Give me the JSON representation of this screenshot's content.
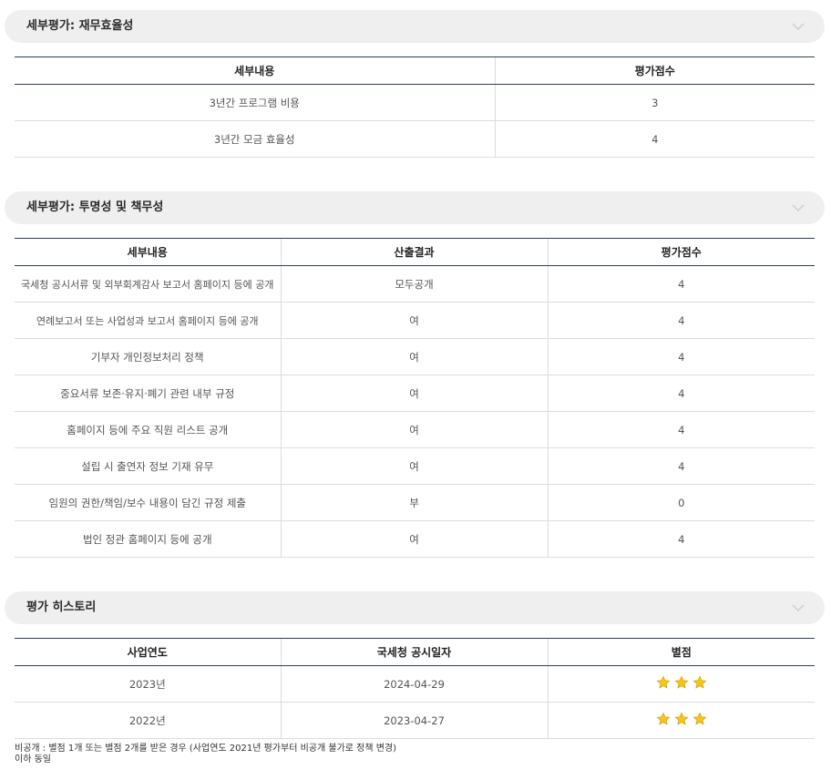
{
  "finance": {
    "title": "세부평가: 재무효율성",
    "headers": [
      "세부내용",
      "평가점수"
    ],
    "rows": [
      [
        "3년간 프로그램 비용",
        "3"
      ],
      [
        "3년간 모금 효율성",
        "4"
      ]
    ]
  },
  "transparency": {
    "title": "세부평가: 투명성 및 책무성",
    "headers": [
      "세부내용",
      "산출결과",
      "평가점수"
    ],
    "rows": [
      [
        "국세청 공시서류 및 외부회계감사 보고서 홈페이지 등에 공개",
        "모두공개",
        "4"
      ],
      [
        "연례보고서 또는 사업성과 보고서 홈페이지 등에 공개",
        "여",
        "4"
      ],
      [
        "기부자 개인정보처리 정책",
        "여",
        "4"
      ],
      [
        "중요서류 보존·유지·폐기 관련 내부 규정",
        "여",
        "4"
      ],
      [
        "홈페이지 등에 주요 직원 리스트 공개",
        "여",
        "4"
      ],
      [
        "설립 시 출연자 정보 기재 유무",
        "여",
        "4"
      ],
      [
        "임원의 권한/책임/보수 내용이 담긴 규정 제출",
        "부",
        "0"
      ],
      [
        "법인 정관 홈페이지 등에 공개",
        "여",
        "4"
      ]
    ]
  },
  "history": {
    "title": "평가 히스토리",
    "headers": [
      "사업연도",
      "국세청 공시일자",
      "별점"
    ],
    "rows": [
      {
        "year": "2023년",
        "date": "2024-04-29",
        "stars": 3
      },
      {
        "year": "2022년",
        "date": "2023-04-27",
        "stars": 3
      }
    ]
  },
  "footnote": {
    "line1": "비공개 : 별점 1개 또는 별점 2개를 받은 경우 (사업연도 2021년 평가부터 비공개 불가로 정책 변경)",
    "line2": "이하 동일"
  },
  "icons": {
    "toggle": "chevron-down-icon",
    "rating": "star-icon"
  },
  "colors": {
    "header_rule": "#2d3a6b",
    "star": "#f5c518",
    "section_bg": "#efefef"
  }
}
